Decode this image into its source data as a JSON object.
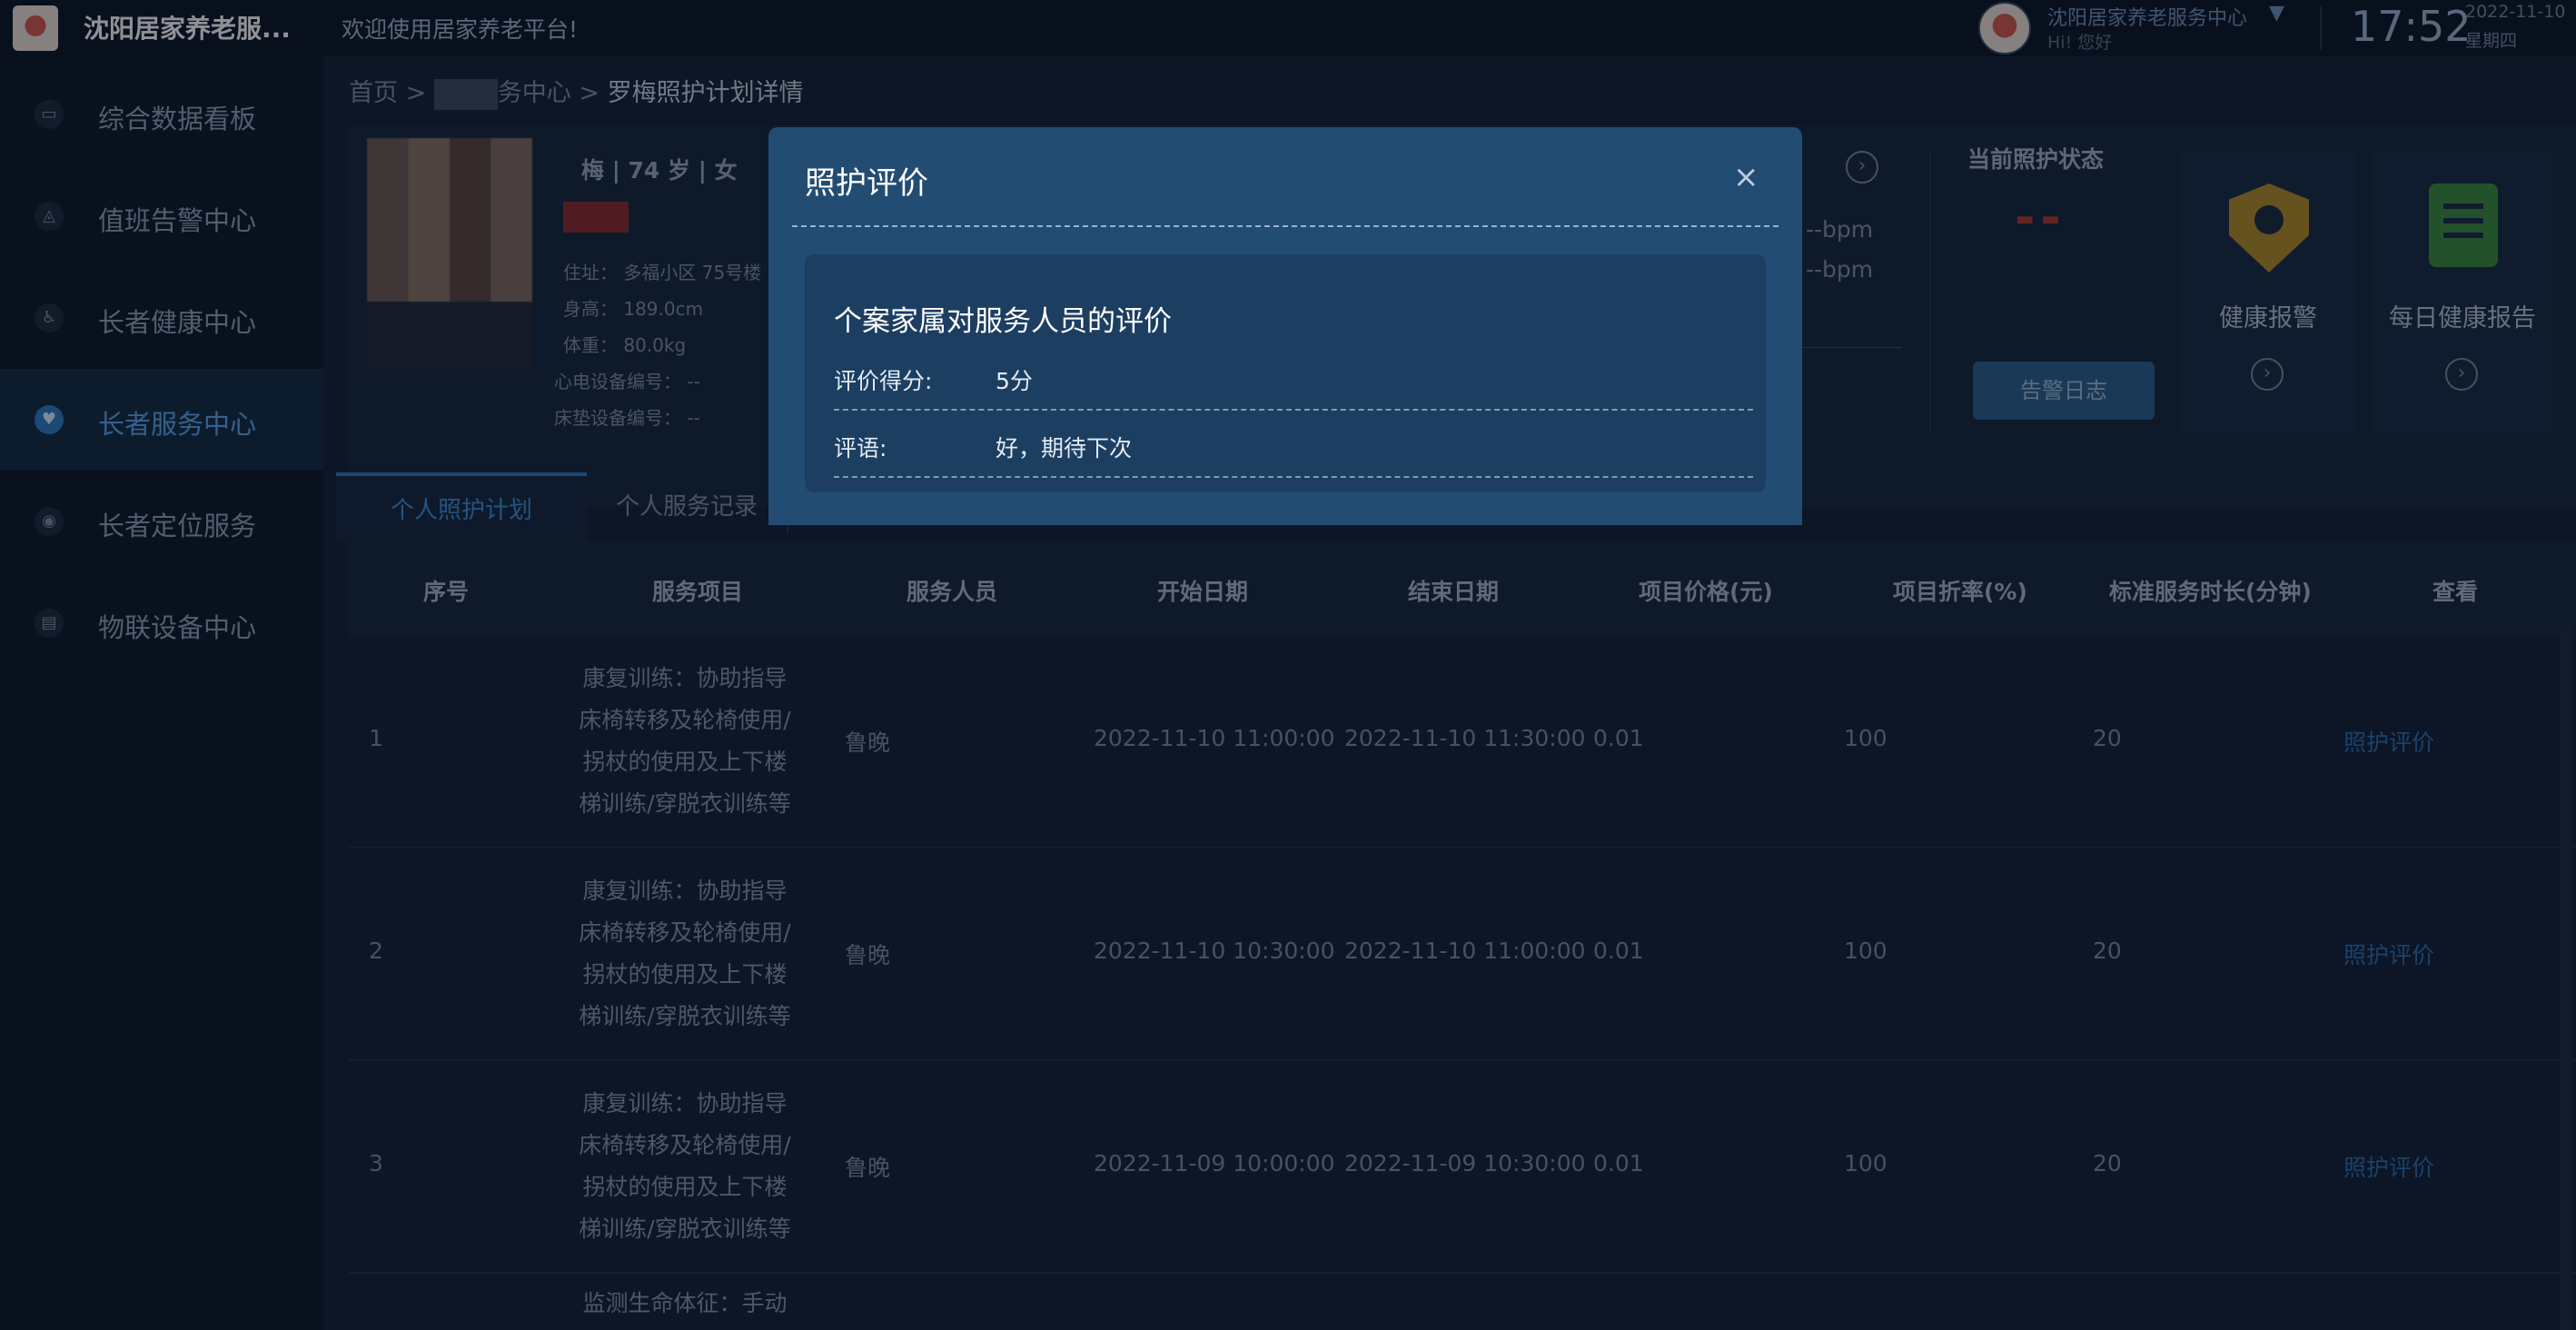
{
  "header": {
    "app_title": "沈阳居家养老服...",
    "welcome": "欢迎使用居家养老平台!",
    "user_name": "沈阳居家养老服务中心",
    "user_greeting": "Hi! 您好",
    "dropdown_glyph": "▼",
    "time": "17:52",
    "date": "2022-11-10",
    "weekday": "星期四"
  },
  "sidebar": {
    "items": [
      {
        "label": "综合数据看板",
        "icon": "dashboard-icon"
      },
      {
        "label": "值班告警中心",
        "icon": "alarm-icon"
      },
      {
        "label": "长者健康中心",
        "icon": "health-icon"
      },
      {
        "label": "长者服务中心",
        "icon": "heart-service-icon",
        "active": true
      },
      {
        "label": "长者定位服务",
        "icon": "location-icon"
      },
      {
        "label": "物联设备中心",
        "icon": "device-icon"
      }
    ]
  },
  "breadcrumb": {
    "home": "首页",
    "sep": ">",
    "middle": "务中心",
    "current": "罗梅照护计划详情"
  },
  "profile": {
    "summary": "梅 | 74 岁 | 女",
    "address": "住址： 多福小区 75号楼",
    "height": "身高： 189.0cm",
    "weight": "体重： 80.0kg",
    "ecg_device": "心电设备编号： --",
    "mattress_device": "床垫设备编号： --",
    "bpm_1": "--bpm",
    "bpm_2": "--bpm"
  },
  "status": {
    "title": "当前照护状态",
    "value": "--",
    "alarm_log_button": "告警日志"
  },
  "func_cards": [
    {
      "label": "健康报警",
      "icon": "shield-user-icon"
    },
    {
      "label": "每日健康报告",
      "icon": "report-scroll-icon"
    }
  ],
  "tabs": [
    {
      "label": "个人照护计划",
      "active": true
    },
    {
      "label": "个人服务记录",
      "active": false
    }
  ],
  "table": {
    "columns": [
      "序号",
      "服务项目",
      "服务人员",
      "开始日期",
      "结束日期",
      "项目价格(元)",
      "项目折率(%)",
      "标准服务时长(分钟)",
      "查看"
    ],
    "rows": [
      {
        "index": "1",
        "service_lines": [
          "康复训练：协助指导",
          "床椅转移及轮椅使用/",
          "拐杖的使用及上下楼",
          "梯训练/穿脱衣训练等"
        ],
        "staff": "鲁晚",
        "start": "2022-11-10 11:00:00",
        "end": "2022-11-10 11:30:00",
        "price": "0.01",
        "discount": "100",
        "duration": "20",
        "action": "照护评价"
      },
      {
        "index": "2",
        "service_lines": [
          "康复训练：协助指导",
          "床椅转移及轮椅使用/",
          "拐杖的使用及上下楼",
          "梯训练/穿脱衣训练等"
        ],
        "staff": "鲁晚",
        "start": "2022-11-10 10:30:00",
        "end": "2022-11-10 11:00:00",
        "price": "0.01",
        "discount": "100",
        "duration": "20",
        "action": "照护评价"
      },
      {
        "index": "3",
        "service_lines": [
          "康复训练：协助指导",
          "床椅转移及轮椅使用/",
          "拐杖的使用及上下楼",
          "梯训练/穿脱衣训练等"
        ],
        "staff": "鲁晚",
        "start": "2022-11-09 10:00:00",
        "end": "2022-11-09 10:30:00",
        "price": "0.01",
        "discount": "100",
        "duration": "20",
        "action": "照护评价"
      },
      {
        "service_lines": [
          "监测生命体征：手动"
        ]
      }
    ]
  },
  "modal": {
    "title": "照护评价",
    "close_glyph": "×",
    "panel_heading": "个案家属对服务人员的评价",
    "score_label": "评价得分:",
    "score_value": "5分",
    "comment_label": "评语:",
    "comment_value": "好，期待下次"
  }
}
